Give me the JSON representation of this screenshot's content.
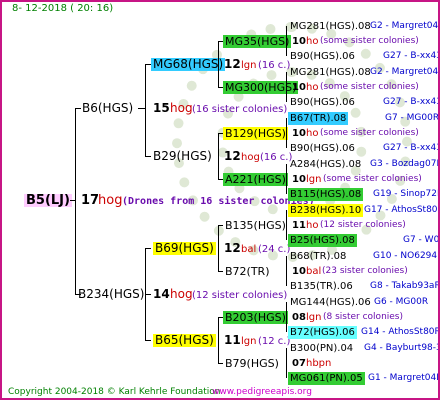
{
  "header": {
    "date": "8- 12-2018 ( 20: 16)"
  },
  "footer": {
    "copyright": "Copyright 2004-2018 © Karl Kehrle Foundation",
    "url": "www.pedigreeapis.org"
  },
  "colors": {
    "border": "#c71585",
    "cyan": "#33ccff",
    "green": "#33cc33",
    "yellow": "#ffff00",
    "pink": "#ffccff",
    "lightblue": "#66ffff"
  },
  "root": {
    "name": "B5(LJ)",
    "gen": "17",
    "breed": "hog",
    "note": "(Drones from 16 sister colonies)"
  },
  "gen1": [
    {
      "name": "B6(HGS)",
      "gen": "15",
      "breed": "hog",
      "note": "(16 sister colonies)"
    },
    {
      "name": "B234(HGS)",
      "gen": "14",
      "breed": "hog",
      "note": "(12 sister colonies)"
    }
  ],
  "gen2": [
    {
      "name": "MG68(HGS)",
      "gen": "12",
      "breed": "lgn",
      "note": "(16 c.)"
    },
    {
      "name": "B29(HGS)",
      "gen": "12",
      "breed": "hog",
      "note": "(16 c.)"
    },
    {
      "name": "B69(HGS)",
      "gen": "12",
      "breed": "bal",
      "note": "(24 c.)"
    },
    {
      "name": "B65(HGS)",
      "gen": "11",
      "breed": "lgn",
      "note": "(12 c.)"
    }
  ],
  "gen3": [
    {
      "name": "MG35(HGS)"
    },
    {
      "name": "MG300(HGS)"
    },
    {
      "name": "B129(HGS)"
    },
    {
      "name": "A221(HGS)"
    },
    {
      "name": "B135(HGS)"
    },
    {
      "name": "B72(TR)"
    },
    {
      "name": "B203(HGS)"
    },
    {
      "name": "B79(HGS)"
    }
  ],
  "gen4": [
    {
      "name": "MG281(HGS).08",
      "right": "G2 - Margret04R"
    },
    {
      "gen": "10",
      "breed": "ho",
      "note": "(some sister colonies)"
    },
    {
      "name": "B90(HGS).06",
      "right": "G27 - B-xx43"
    },
    {
      "name": "MG281(HGS).08",
      "right": "G2 - Margret04R"
    },
    {
      "gen": "10",
      "breed": "ho",
      "note": "(some sister colonies)"
    },
    {
      "name": "B90(HGS).06",
      "right": "G27 - B-xx43"
    },
    {
      "name": "B67(TR).08",
      "right": "G7 - MG00R"
    },
    {
      "gen": "10",
      "breed": "ho",
      "note": "(some sister colonies)"
    },
    {
      "name": "B90(HGS).06",
      "right": "G27 - B-xx43"
    },
    {
      "name": "A284(HGS).08",
      "right": "G3 - Bozdag07R"
    },
    {
      "gen": "10",
      "breed": "lgn",
      "note": "(some sister colonies)"
    },
    {
      "name": "B115(HGS).08",
      "right": "G19 - Sinop72R"
    },
    {
      "name": "B238(HGS).10",
      "right": "G17 - AthosSt80R"
    },
    {
      "gen": "11",
      "breed": "ho",
      "note": "(12 sister colonies)"
    },
    {
      "name": "B25(HGS).08",
      "right": "G7 - W0"
    },
    {
      "name": "B68(TR).08",
      "right": "G10 - NO6294R"
    },
    {
      "gen": "10",
      "breed": "bal",
      "note": "(23 sister colonies)"
    },
    {
      "name": "B135(TR).06",
      "right": "G8 - Takab93aR"
    },
    {
      "name": "MG144(HGS).06",
      "right": "G6 - MG00R"
    },
    {
      "gen": "08",
      "breed": "lgn",
      "note": "(8 sister colonies)"
    },
    {
      "name": "B72(HGS).06",
      "right": "G14 - AthosSt80R"
    },
    {
      "name": "B300(PN).04",
      "right": "G4 - Bayburt98-3"
    },
    {
      "gen": "07",
      "breed": "hbpn",
      "note": ""
    },
    {
      "name": "MG061(PN).05",
      "right": "G1 - Margret04R"
    }
  ]
}
